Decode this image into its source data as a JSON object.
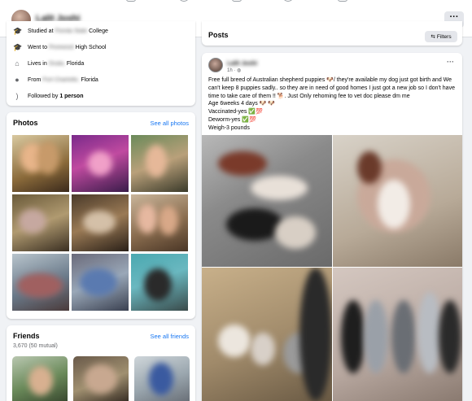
{
  "topbar": {
    "profile_name": "Lalit Joshi",
    "more_label": "···"
  },
  "intro": {
    "studied": {
      "prefix": "Studied at",
      "school_blurred": "Florida State",
      "suffix": "College"
    },
    "went": {
      "prefix": "Went to",
      "school_blurred": "Pinewood",
      "suffix": "High School"
    },
    "lives": {
      "prefix": "Lives in",
      "city_blurred": "Ocala,",
      "suffix": "Florida"
    },
    "from": {
      "prefix": "From",
      "city_blurred": "Port Charlotte,",
      "suffix": "Florida"
    },
    "followed": {
      "prefix": "Followed by",
      "count": "1 person"
    }
  },
  "photos": {
    "title": "Photos",
    "link": "See all photos"
  },
  "friends": {
    "title": "Friends",
    "link": "See all friends",
    "count": "3,670 (50 mutual)"
  },
  "posts": {
    "title": "Posts",
    "filters_label": "Filters"
  },
  "post": {
    "author": "Lalit Joshi",
    "time": "1h · ◍",
    "more_label": "···",
    "lines": [
      "Free full breed of Australian shepherd puppies 🐶/ they're available my dog just got birth and We can't keep 8 puppies sadly.. so they are in need of good homes I just got a new job so I don't have time to take care of them !! 🐕. Just Only rehoming fee to vet doc please dm me",
      "Age 6weeks 4 days 🐶 🐶",
      "Vaccinated-yes ✅💯",
      "Deworm-yes ✅💯",
      "Weigh-3 pounds"
    ]
  },
  "colors": {
    "page_bg": "#f0f2f5",
    "card_bg": "#ffffff",
    "link_blue": "#1877f2",
    "secondary_text": "#65676b"
  },
  "icons": {
    "studied": "graduation-cap-icon",
    "went": "graduation-cap-icon",
    "lives": "home-icon",
    "from": "location-pin-icon",
    "followed": "rss-icon",
    "filters": "sliders-icon"
  }
}
